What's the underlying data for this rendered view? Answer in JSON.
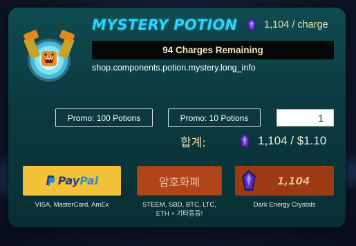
{
  "product": {
    "title": "MYSTERY POTION",
    "price_per_charge": "1,104 / charge",
    "charges_remaining": "94 Charges Remaining",
    "info_text": "shop.components.potion.mystery.long_info"
  },
  "purchase": {
    "promo_100_label": "Promo: 100 Potions",
    "promo_10_label": "Promo: 10 Potions",
    "quantity_value": "1",
    "total_label": "합계:",
    "total_value": "1,104 / $1.10"
  },
  "payment": {
    "paypal": {
      "logo_part1": "Pay",
      "logo_part2": "Pal",
      "caption": "VISA, MasterCard, AmEx"
    },
    "crypto": {
      "label": "암호화폐",
      "caption_line1": "STEEM, SBD, BTC, LTC,",
      "caption_line2": "ETH + 기타등등!"
    },
    "dec": {
      "amount": "1,104",
      "caption": "Dark Energy Crystals"
    }
  },
  "colors": {
    "title": "#29d4ff",
    "panel": "#0f4c50",
    "paypal_button": "#f3c13a",
    "crypto_button": "#b0451a",
    "dec_button": "#9c3a13"
  },
  "icons": [
    "potion-icon",
    "dark-energy-crystal-icon",
    "paypal-icon"
  ]
}
